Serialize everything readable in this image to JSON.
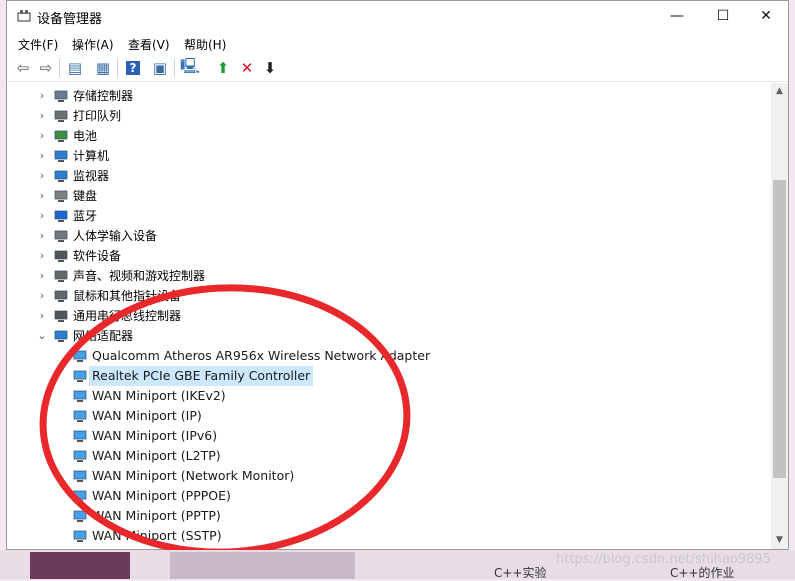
{
  "window": {
    "title": "设备管理器",
    "controls": {
      "minimize": "—",
      "maximize": "☐",
      "close": "✕"
    }
  },
  "menu": [
    "文件(F)",
    "操作(A)",
    "查看(V)",
    "帮助(H)"
  ],
  "toolbar": [
    {
      "name": "back-icon",
      "glyph": "⇦",
      "color": "#5a5a5a"
    },
    {
      "name": "forward-icon",
      "glyph": "⇨",
      "color": "#5a5a5a"
    },
    {
      "name": "show-hide-console-tree-icon",
      "glyph": "▤",
      "color": "#3a6ea5"
    },
    {
      "name": "properties-icon",
      "glyph": "▦",
      "color": "#3a6ea5"
    },
    {
      "name": "help-icon",
      "glyph": "?",
      "color": "#ffffff",
      "bg": "#2b5fb8"
    },
    {
      "name": "action-pane-icon",
      "glyph": "▣",
      "color": "#3a6ea5"
    },
    {
      "name": "scan-hardware-icon",
      "glyph": "🖳",
      "color": "#2f6db5"
    },
    {
      "name": "update-driver-icon",
      "glyph": "⬆",
      "color": "#1f9a3a"
    },
    {
      "name": "uninstall-device-icon",
      "glyph": "✕",
      "color": "#d8151b"
    },
    {
      "name": "disable-device-icon",
      "glyph": "⬇",
      "color": "#222222"
    }
  ],
  "tree": {
    "categories": [
      {
        "label": "存储控制器",
        "icon": "storage-controller-icon",
        "color": "#6b7c8c",
        "expanded": false
      },
      {
        "label": "打印队列",
        "icon": "printer-icon",
        "color": "#707070",
        "expanded": false
      },
      {
        "label": "电池",
        "icon": "battery-icon",
        "color": "#3f8f3f",
        "expanded": false
      },
      {
        "label": "计算机",
        "icon": "computer-icon",
        "color": "#2f7fd0",
        "expanded": false
      },
      {
        "label": "监视器",
        "icon": "monitor-icon",
        "color": "#2f7fd0",
        "expanded": false
      },
      {
        "label": "键盘",
        "icon": "keyboard-icon",
        "color": "#808080",
        "expanded": false
      },
      {
        "label": "蓝牙",
        "icon": "bluetooth-icon",
        "color": "#1e66d1",
        "expanded": false
      },
      {
        "label": "人体学输入设备",
        "icon": "hid-icon",
        "color": "#777777",
        "expanded": false
      },
      {
        "label": "软件设备",
        "icon": "software-device-icon",
        "color": "#555555",
        "expanded": false
      },
      {
        "label": "声音、视频和游戏控制器",
        "icon": "speaker-icon",
        "color": "#666666",
        "expanded": false
      },
      {
        "label": "鼠标和其他指针设备",
        "icon": "mouse-icon",
        "color": "#666666",
        "expanded": false
      },
      {
        "label": "通用串行总线控制器",
        "icon": "usb-icon",
        "color": "#555555",
        "expanded": false
      },
      {
        "label": "网络适配器",
        "icon": "network-adapter-icon",
        "color": "#2f7fd0",
        "expanded": true
      }
    ],
    "network_adapters": [
      {
        "label": "Qualcomm Atheros AR956x Wireless Network Adapter",
        "selected": false
      },
      {
        "label": "Realtek PCIe GBE Family Controller",
        "selected": true
      },
      {
        "label": "WAN Miniport (IKEv2)",
        "selected": false
      },
      {
        "label": "WAN Miniport (IP)",
        "selected": false
      },
      {
        "label": "WAN Miniport (IPv6)",
        "selected": false
      },
      {
        "label": "WAN Miniport (L2TP)",
        "selected": false
      },
      {
        "label": "WAN Miniport (Network Monitor)",
        "selected": false
      },
      {
        "label": "WAN Miniport (PPPOE)",
        "selected": false
      },
      {
        "label": "WAN Miniport (PPTP)",
        "selected": false
      },
      {
        "label": "WAN Miniport (SSTP)",
        "selected": false
      }
    ]
  },
  "annotation": {
    "circle_color": "#e8282b"
  },
  "taskbar": {
    "item1": "C++实验",
    "item2": "C++的作业"
  },
  "watermark": "https://blog.csdn.net/shihao9895"
}
